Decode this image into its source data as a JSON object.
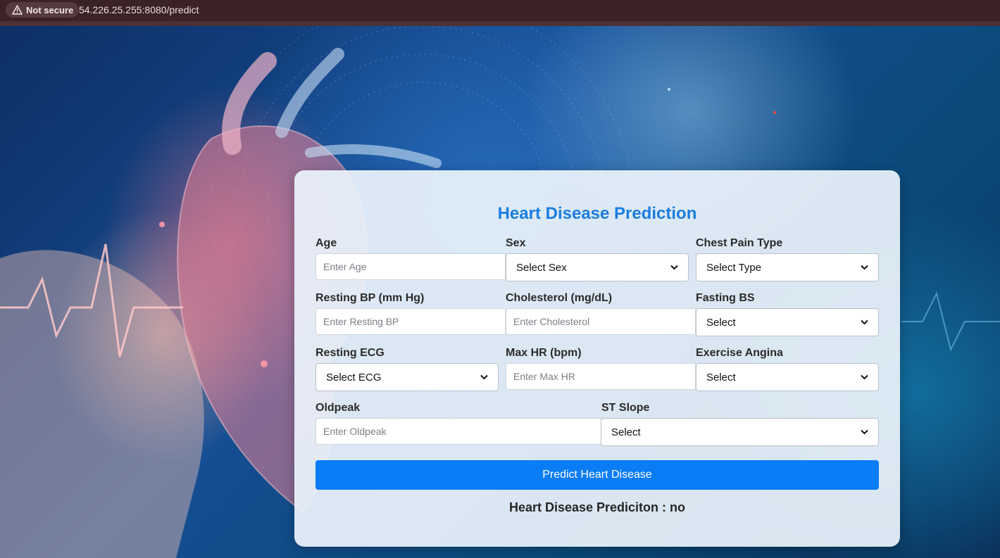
{
  "browser": {
    "security_label": "Not secure",
    "url": "54.226.25.255:8080/predict"
  },
  "form": {
    "title": "Heart Disease Prediction",
    "fields": {
      "age": {
        "label": "Age",
        "placeholder": "Enter Age"
      },
      "sex": {
        "label": "Sex",
        "selected": "Select Sex"
      },
      "chest_pain": {
        "label": "Chest Pain Type",
        "selected": "Select Type"
      },
      "resting_bp": {
        "label": "Resting BP (mm Hg)",
        "placeholder": "Enter Resting BP"
      },
      "cholesterol": {
        "label": "Cholesterol (mg/dL)",
        "placeholder": "Enter Cholesterol"
      },
      "fasting_bs": {
        "label": "Fasting BS",
        "selected": "Select"
      },
      "resting_ecg": {
        "label": "Resting ECG",
        "selected": "Select ECG"
      },
      "max_hr": {
        "label": "Max HR (bpm)",
        "placeholder": "Enter Max HR"
      },
      "exercise_angina": {
        "label": "Exercise Angina",
        "selected": "Select"
      },
      "oldpeak": {
        "label": "Oldpeak",
        "placeholder": "Enter Oldpeak"
      },
      "st_slope": {
        "label": "ST Slope",
        "selected": "Select"
      }
    },
    "submit_label": "Predict Heart Disease",
    "result_text": "Heart Disease Prediciton : no"
  },
  "colors": {
    "accent": "#0a7cf6",
    "title": "#1a7de0",
    "chrome": "#3a2226"
  }
}
